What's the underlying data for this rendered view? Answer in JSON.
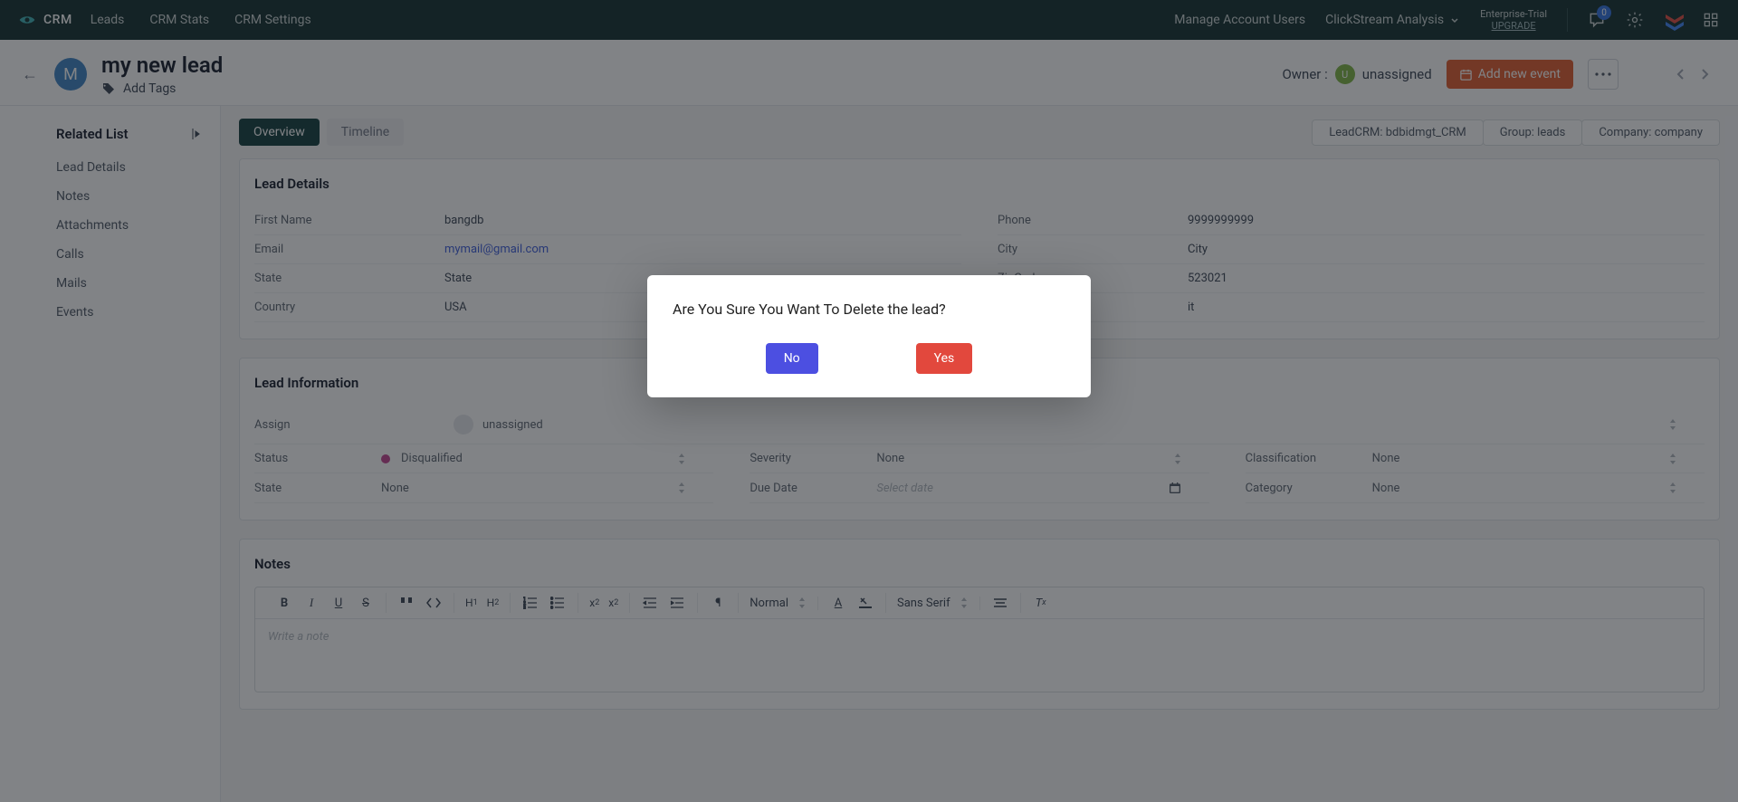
{
  "topnav": {
    "brand": "CRM",
    "items": [
      "Leads",
      "CRM Stats",
      "CRM Settings"
    ],
    "right": {
      "manage": "Manage Account Users",
      "clickstream": "ClickStream Analysis",
      "trial": "Enterprise-Trial",
      "upgrade": "UPGRADE",
      "inbox_badge": "0"
    }
  },
  "header": {
    "avatar_letter": "M",
    "title": "my new lead",
    "add_tags": "Add Tags",
    "owner_label": "Owner :",
    "owner_avatar": "U",
    "owner_name": "unassigned",
    "add_event": "Add new event"
  },
  "sidebar": {
    "title": "Related List",
    "items": [
      "Lead Details",
      "Notes",
      "Attachments",
      "Calls",
      "Mails",
      "Events"
    ]
  },
  "tabs": {
    "overview": "Overview",
    "timeline": "Timeline"
  },
  "breadcrumb": {
    "p1": "LeadCRM: bdbidmgt_CRM",
    "p2": "Group: leads",
    "p3": "Company: company"
  },
  "lead_details": {
    "title": "Lead Details",
    "rows_left": [
      {
        "label": "First Name",
        "value": "bangdb"
      },
      {
        "label": "Email",
        "value": "mymail@gmail.com",
        "is_link": true
      },
      {
        "label": "State",
        "value": "State"
      },
      {
        "label": "Country",
        "value": "USA"
      }
    ],
    "rows_right": [
      {
        "label": "Phone",
        "value": "9999999999"
      },
      {
        "label": "City",
        "value": "City"
      },
      {
        "label": "ZipCode",
        "value": "523021"
      },
      {
        "label": "",
        "value": "it"
      }
    ]
  },
  "lead_info": {
    "title": "Lead Information",
    "assign_label": "Assign",
    "assign_value": "unassigned",
    "grid": [
      [
        {
          "label": "Status",
          "value": "Disqualified",
          "dot": true
        },
        {
          "label": "Severity",
          "value": "None"
        },
        {
          "label": "Classification",
          "value": "None"
        }
      ],
      [
        {
          "label": "State",
          "value": "None"
        },
        {
          "label": "Due Date",
          "value": "Select date",
          "placeholder": true,
          "date": true
        },
        {
          "label": "Category",
          "value": "None"
        }
      ]
    ]
  },
  "notes": {
    "title": "Notes",
    "placeholder": "Write a note",
    "size_select": "Normal",
    "font_select": "Sans Serif"
  },
  "modal": {
    "text": "Are You Sure You Want To Delete the lead?",
    "no": "No",
    "yes": "Yes"
  }
}
